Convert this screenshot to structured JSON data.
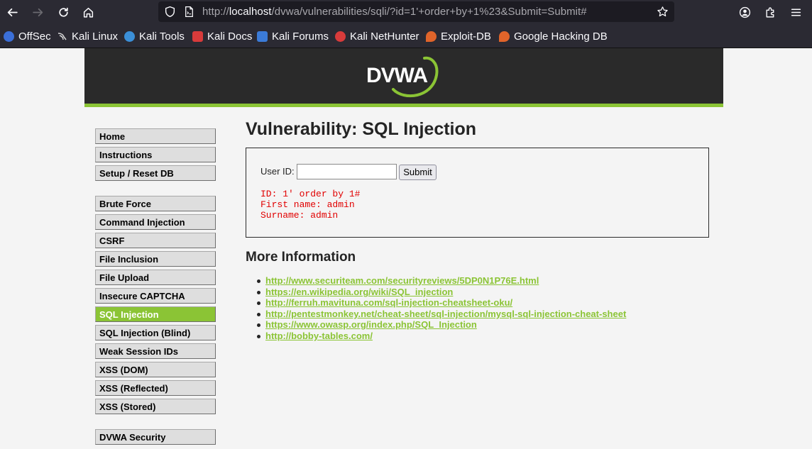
{
  "browser": {
    "url_prefix": "http://",
    "url_host": "localhost",
    "url_path": "/dvwa/vulnerabilities/sqli/?id=1'+order+by+1%23&Submit=Submit#",
    "bookmarks": [
      {
        "label": "OffSec",
        "icon": "offsec-icon",
        "color": "#3b6fd8"
      },
      {
        "label": "Kali Linux",
        "icon": "kali-dragon-icon",
        "color": "#cfcfcf"
      },
      {
        "label": "Kali Tools",
        "icon": "kali-tools-icon",
        "color": "#3b8fd8"
      },
      {
        "label": "Kali Docs",
        "icon": "kali-docs-icon",
        "color": "#d83b3b"
      },
      {
        "label": "Kali Forums",
        "icon": "kali-forums-icon",
        "color": "#3b7bd8"
      },
      {
        "label": "Kali NetHunter",
        "icon": "nethunter-icon",
        "color": "#d83b3b"
      },
      {
        "label": "Exploit-DB",
        "icon": "exploit-db-icon",
        "color": "#e0642a"
      },
      {
        "label": "Google Hacking DB",
        "icon": "ghdb-icon",
        "color": "#e0642a"
      }
    ]
  },
  "app": {
    "logo_text": "DVWA",
    "accent_color": "#8bc435"
  },
  "menu": {
    "items": [
      {
        "label": "Home"
      },
      {
        "label": "Instructions"
      },
      {
        "label": "Setup / Reset DB"
      },
      {
        "label": "Brute Force"
      },
      {
        "label": "Command Injection"
      },
      {
        "label": "CSRF"
      },
      {
        "label": "File Inclusion"
      },
      {
        "label": "File Upload"
      },
      {
        "label": "Insecure CAPTCHA"
      },
      {
        "label": "SQL Injection",
        "active": true
      },
      {
        "label": "SQL Injection (Blind)"
      },
      {
        "label": "Weak Session IDs"
      },
      {
        "label": "XSS (DOM)"
      },
      {
        "label": "XSS (Reflected)"
      },
      {
        "label": "XSS (Stored)"
      },
      {
        "label": "DVWA Security"
      }
    ]
  },
  "main": {
    "title": "Vulnerability: SQL Injection",
    "form": {
      "user_id_label": "User ID:",
      "user_id_value": "",
      "submit_label": "Submit"
    },
    "result": {
      "id_line": "ID: 1' order by 1#",
      "first_name_line": "First name: admin",
      "surname_line": "Surname: admin"
    },
    "more_info_title": "More Information",
    "links": [
      "http://www.securiteam.com/securityreviews/5DP0N1P76E.html",
      "https://en.wikipedia.org/wiki/SQL_injection",
      "http://ferruh.mavituna.com/sql-injection-cheatsheet-oku/",
      "http://pentestmonkey.net/cheat-sheet/sql-injection/mysql-sql-injection-cheat-sheet",
      "https://www.owasp.org/index.php/SQL_Injection",
      "http://bobby-tables.com/"
    ]
  }
}
